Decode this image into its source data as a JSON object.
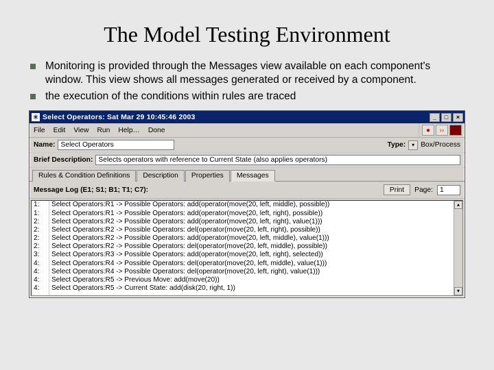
{
  "slide": {
    "title": "The Model Testing Environment",
    "bullets": [
      "Monitoring is provided through the Messages view available on each component's window. This view shows all messages generated or received by a component.",
      "the execution of the conditions within rules are traced"
    ]
  },
  "win": {
    "title": "Select Operators: Sat Mar 29 10:45:46 2003",
    "controls": {
      "min": "_",
      "max": "□",
      "close": "×"
    },
    "menu": [
      "File",
      "Edit",
      "View",
      "Run",
      "Help…",
      "Done"
    ],
    "toolbar": {
      "rec": "●",
      "ff": "››",
      "stop": "■"
    },
    "nameLabel": "Name:",
    "nameValue": "Select Operators",
    "typeLabel": "Type:",
    "typeValue": "Box/Process",
    "briefLabel": "Brief Description:",
    "briefValue": "Selects operators with reference to Current State (also applies operators)",
    "tabs": [
      "Rules & Condition Definitions",
      "Description",
      "Properties",
      "Messages"
    ],
    "activeTab": 3,
    "logLabel": "Message Log (E1; S1; B1; T1; C7):",
    "printBtn": "Print",
    "pageLabel": "Page:",
    "pageValue": "1",
    "log": [
      {
        "i": "1:",
        "m": "Select Operators:R1 -> Possible Operators: add(operator(move(20, left, middle), possible))"
      },
      {
        "i": "1:",
        "m": "Select Operators:R1 -> Possible Operators: add(operator(move(20, left, right), possible))"
      },
      {
        "i": "2:",
        "m": "Select Operators:R2 -> Possible Operators: add(operator(move(20, left, right), value(1)))"
      },
      {
        "i": "2:",
        "m": "Select Operators:R2 -> Possible Operators: del(operator(move(20, left, right), possible))"
      },
      {
        "i": "2:",
        "m": "Select Operators:R2 -> Possible Operators: add(operator(move(20, left, middle), value(1)))"
      },
      {
        "i": "2:",
        "m": "Select Operators:R2 -> Possible Operators: del(operator(move(20, left, middle), possible))"
      },
      {
        "i": "3:",
        "m": "Select Operators:R3 -> Possible Operators: add(operator(move(20, left, right), selected))"
      },
      {
        "i": "4:",
        "m": "Select Operators:R4 -> Possible Operators: del(operator(move(20, left, middle), value(1)))"
      },
      {
        "i": "4:",
        "m": "Select Operators:R4 -> Possible Operators: del(operator(move(20, left, right), value(1)))"
      },
      {
        "i": "4:",
        "m": "Select Operators:R5 -> Previous Move: add(move(20))"
      },
      {
        "i": "4:",
        "m": "Select Operators:R5 -> Current State: add(disk(20, right, 1))"
      }
    ]
  }
}
